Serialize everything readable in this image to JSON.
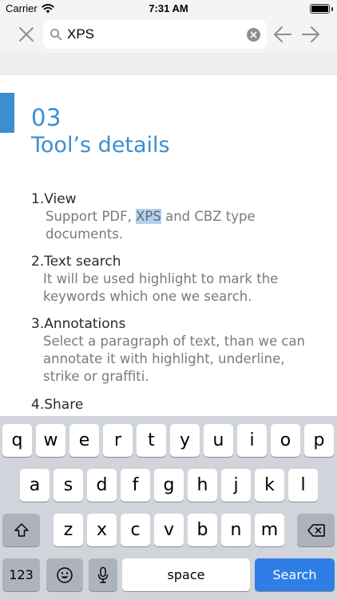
{
  "status_bar": {
    "carrier": "Carrier",
    "time": "7:31 AM",
    "battery_level": 1.0
  },
  "search": {
    "query": "XPS",
    "placeholder": ""
  },
  "icons": {
    "close": "close-icon",
    "search": "search-icon",
    "clear": "clear-circle-icon",
    "prev": "arrow-left-icon",
    "next": "arrow-right-icon",
    "shift": "shift-icon",
    "delete": "backspace-icon",
    "emoji": "emoji-icon",
    "mic": "microphone-icon"
  },
  "document": {
    "chapter_number": "03",
    "chapter_title": "Tool’s details",
    "sections": [
      {
        "heading": "1.View",
        "lines": [
          [
            "Support PDF, ",
            "XPS",
            " and CBZ type"
          ],
          [
            "documents."
          ]
        ]
      },
      {
        "heading": "2.Text search",
        "lines": [
          [
            "It will be used  highlight to mark the"
          ],
          [
            "keywords which one we search."
          ]
        ]
      },
      {
        "heading": "3.Annotations",
        "lines": [
          [
            "Select a paragraph of text, than we can"
          ],
          [
            "annotate it with highlight, underline,"
          ],
          [
            "strike or graffiti."
          ]
        ]
      },
      {
        "heading": "4.Share"
      }
    ]
  },
  "keyboard": {
    "row1": [
      "q",
      "w",
      "e",
      "r",
      "t",
      "y",
      "u",
      "i",
      "o",
      "p"
    ],
    "row2": [
      "a",
      "s",
      "d",
      "f",
      "g",
      "h",
      "j",
      "k",
      "l"
    ],
    "row3": [
      "z",
      "x",
      "c",
      "v",
      "b",
      "n",
      "m"
    ],
    "numbers_key": "123",
    "space_key": "space",
    "search_key": "Search"
  },
  "colors": {
    "accent": "#3a8fd3",
    "highlight": "#b3d1ef",
    "search_key": "#2f7ee6",
    "keyboard_bg": "#d1d4da"
  }
}
